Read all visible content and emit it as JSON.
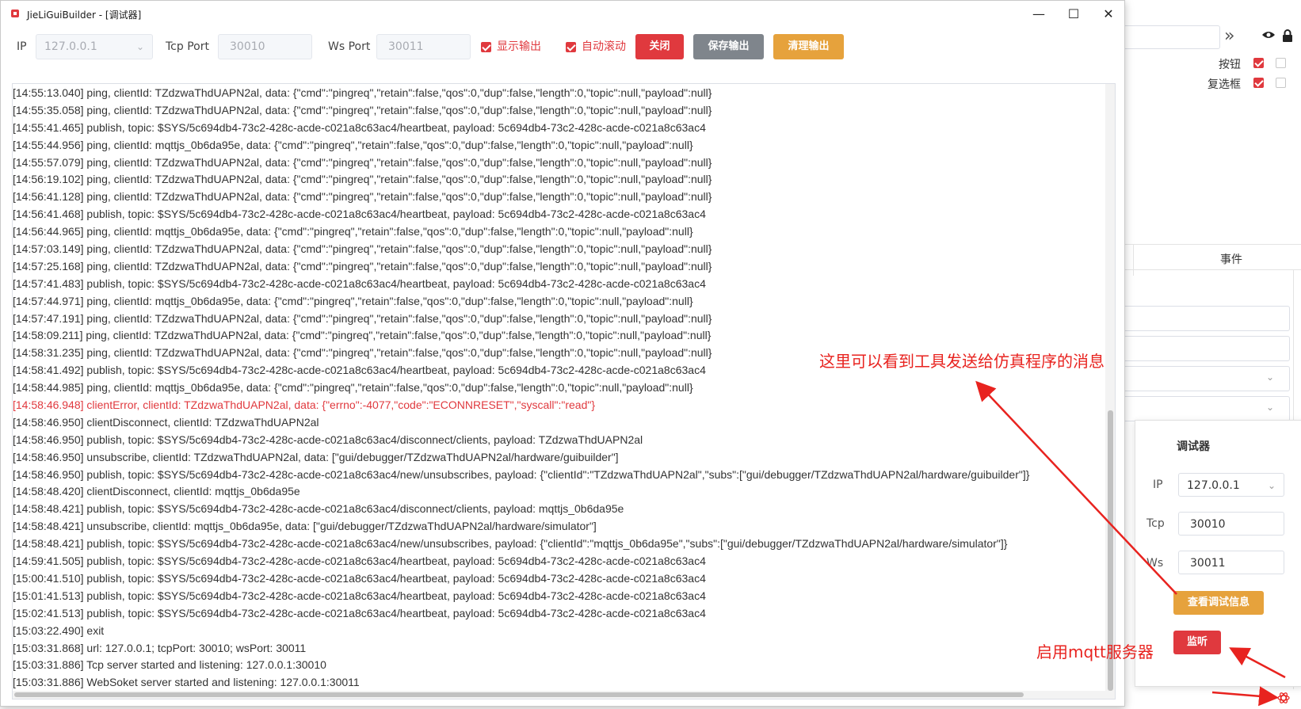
{
  "window": {
    "title": "JieLiGuiBuilder - [调试器]",
    "controls": {
      "minimize": "—",
      "maximize": "☐",
      "close": "✕"
    }
  },
  "toolbar": {
    "ip_label": "IP",
    "ip_value": "127.0.0.1",
    "tcp_label": "Tcp Port",
    "tcp_value": "30010",
    "ws_label": "Ws Port",
    "ws_value": "30011",
    "show_output_label": "显示输出",
    "show_output_checked": true,
    "auto_scroll_label": "自动滚动",
    "auto_scroll_checked": true,
    "close_label": "关闭",
    "save_label": "保存输出",
    "clear_label": "清理输出"
  },
  "log_lines": [
    {
      "text": "[14:55:13.040] ping, clientId: TZdzwaThdUAPN2al, data: {\"cmd\":\"pingreq\",\"retain\":false,\"qos\":0,\"dup\":false,\"length\":0,\"topic\":null,\"payload\":null}",
      "error": false
    },
    {
      "text": "[14:55:35.058] ping, clientId: TZdzwaThdUAPN2al, data: {\"cmd\":\"pingreq\",\"retain\":false,\"qos\":0,\"dup\":false,\"length\":0,\"topic\":null,\"payload\":null}",
      "error": false
    },
    {
      "text": "[14:55:41.465] publish, topic: $SYS/5c694db4-73c2-428c-acde-c021a8c63ac4/heartbeat, payload: 5c694db4-73c2-428c-acde-c021a8c63ac4",
      "error": false
    },
    {
      "text": "[14:55:44.956] ping, clientId: mqttjs_0b6da95e, data: {\"cmd\":\"pingreq\",\"retain\":false,\"qos\":0,\"dup\":false,\"length\":0,\"topic\":null,\"payload\":null}",
      "error": false
    },
    {
      "text": "[14:55:57.079] ping, clientId: TZdzwaThdUAPN2al, data: {\"cmd\":\"pingreq\",\"retain\":false,\"qos\":0,\"dup\":false,\"length\":0,\"topic\":null,\"payload\":null}",
      "error": false
    },
    {
      "text": "[14:56:19.102] ping, clientId: TZdzwaThdUAPN2al, data: {\"cmd\":\"pingreq\",\"retain\":false,\"qos\":0,\"dup\":false,\"length\":0,\"topic\":null,\"payload\":null}",
      "error": false
    },
    {
      "text": "[14:56:41.128] ping, clientId: TZdzwaThdUAPN2al, data: {\"cmd\":\"pingreq\",\"retain\":false,\"qos\":0,\"dup\":false,\"length\":0,\"topic\":null,\"payload\":null}",
      "error": false
    },
    {
      "text": "[14:56:41.468] publish, topic: $SYS/5c694db4-73c2-428c-acde-c021a8c63ac4/heartbeat, payload: 5c694db4-73c2-428c-acde-c021a8c63ac4",
      "error": false
    },
    {
      "text": "[14:56:44.965] ping, clientId: mqttjs_0b6da95e, data: {\"cmd\":\"pingreq\",\"retain\":false,\"qos\":0,\"dup\":false,\"length\":0,\"topic\":null,\"payload\":null}",
      "error": false
    },
    {
      "text": "[14:57:03.149] ping, clientId: TZdzwaThdUAPN2al, data: {\"cmd\":\"pingreq\",\"retain\":false,\"qos\":0,\"dup\":false,\"length\":0,\"topic\":null,\"payload\":null}",
      "error": false
    },
    {
      "text": "[14:57:25.168] ping, clientId: TZdzwaThdUAPN2al, data: {\"cmd\":\"pingreq\",\"retain\":false,\"qos\":0,\"dup\":false,\"length\":0,\"topic\":null,\"payload\":null}",
      "error": false
    },
    {
      "text": "[14:57:41.483] publish, topic: $SYS/5c694db4-73c2-428c-acde-c021a8c63ac4/heartbeat, payload: 5c694db4-73c2-428c-acde-c021a8c63ac4",
      "error": false
    },
    {
      "text": "[14:57:44.971] ping, clientId: mqttjs_0b6da95e, data: {\"cmd\":\"pingreq\",\"retain\":false,\"qos\":0,\"dup\":false,\"length\":0,\"topic\":null,\"payload\":null}",
      "error": false
    },
    {
      "text": "[14:57:47.191] ping, clientId: TZdzwaThdUAPN2al, data: {\"cmd\":\"pingreq\",\"retain\":false,\"qos\":0,\"dup\":false,\"length\":0,\"topic\":null,\"payload\":null}",
      "error": false
    },
    {
      "text": "[14:58:09.211] ping, clientId: TZdzwaThdUAPN2al, data: {\"cmd\":\"pingreq\",\"retain\":false,\"qos\":0,\"dup\":false,\"length\":0,\"topic\":null,\"payload\":null}",
      "error": false
    },
    {
      "text": "[14:58:31.235] ping, clientId: TZdzwaThdUAPN2al, data: {\"cmd\":\"pingreq\",\"retain\":false,\"qos\":0,\"dup\":false,\"length\":0,\"topic\":null,\"payload\":null}",
      "error": false
    },
    {
      "text": "[14:58:41.492] publish, topic: $SYS/5c694db4-73c2-428c-acde-c021a8c63ac4/heartbeat, payload: 5c694db4-73c2-428c-acde-c021a8c63ac4",
      "error": false
    },
    {
      "text": "[14:58:44.985] ping, clientId: mqttjs_0b6da95e, data: {\"cmd\":\"pingreq\",\"retain\":false,\"qos\":0,\"dup\":false,\"length\":0,\"topic\":null,\"payload\":null}",
      "error": false
    },
    {
      "text": "[14:58:46.948] clientError, clientId: TZdzwaThdUAPN2al, data: {\"errno\":-4077,\"code\":\"ECONNRESET\",\"syscall\":\"read\"}",
      "error": true
    },
    {
      "text": "[14:58:46.950] clientDisconnect, clientId: TZdzwaThdUAPN2al",
      "error": false
    },
    {
      "text": "[14:58:46.950] publish, topic: $SYS/5c694db4-73c2-428c-acde-c021a8c63ac4/disconnect/clients, payload: TZdzwaThdUAPN2al",
      "error": false
    },
    {
      "text": "[14:58:46.950] unsubscribe, clientId: TZdzwaThdUAPN2al, data: [\"gui/debugger/TZdzwaThdUAPN2al/hardware/guibuilder\"]",
      "error": false
    },
    {
      "text": "[14:58:46.950] publish, topic: $SYS/5c694db4-73c2-428c-acde-c021a8c63ac4/new/unsubscribes, payload: {\"clientId\":\"TZdzwaThdUAPN2al\",\"subs\":[\"gui/debugger/TZdzwaThdUAPN2al/hardware/guibuilder\"]}",
      "error": false
    },
    {
      "text": "[14:58:48.420] clientDisconnect, clientId: mqttjs_0b6da95e",
      "error": false
    },
    {
      "text": "[14:58:48.421] publish, topic: $SYS/5c694db4-73c2-428c-acde-c021a8c63ac4/disconnect/clients, payload: mqttjs_0b6da95e",
      "error": false
    },
    {
      "text": "[14:58:48.421] unsubscribe, clientId: mqttjs_0b6da95e, data: [\"gui/debugger/TZdzwaThdUAPN2al/hardware/simulator\"]",
      "error": false
    },
    {
      "text": "[14:58:48.421] publish, topic: $SYS/5c694db4-73c2-428c-acde-c021a8c63ac4/new/unsubscribes, payload: {\"clientId\":\"mqttjs_0b6da95e\",\"subs\":[\"gui/debugger/TZdzwaThdUAPN2al/hardware/simulator\"]}",
      "error": false
    },
    {
      "text": "[14:59:41.505] publish, topic: $SYS/5c694db4-73c2-428c-acde-c021a8c63ac4/heartbeat, payload: 5c694db4-73c2-428c-acde-c021a8c63ac4",
      "error": false
    },
    {
      "text": "[15:00:41.510] publish, topic: $SYS/5c694db4-73c2-428c-acde-c021a8c63ac4/heartbeat, payload: 5c694db4-73c2-428c-acde-c021a8c63ac4",
      "error": false
    },
    {
      "text": "[15:01:41.513] publish, topic: $SYS/5c694db4-73c2-428c-acde-c021a8c63ac4/heartbeat, payload: 5c694db4-73c2-428c-acde-c021a8c63ac4",
      "error": false
    },
    {
      "text": "[15:02:41.513] publish, topic: $SYS/5c694db4-73c2-428c-acde-c021a8c63ac4/heartbeat, payload: 5c694db4-73c2-428c-acde-c021a8c63ac4",
      "error": false
    },
    {
      "text": "[15:03:22.490] exit",
      "error": false
    },
    {
      "text": "[15:03:31.868] url: 127.0.0.1; tcpPort: 30010; wsPort: 30011",
      "error": false
    },
    {
      "text": "[15:03:31.886] Tcp server started and listening: 127.0.0.1:30010",
      "error": false
    },
    {
      "text": "[15:03:31.886] WebSoket server started and listening: 127.0.0.1:30011",
      "error": false
    }
  ],
  "background_panel": {
    "row_button_label": "按钮",
    "row_checkbox_label": "复选框",
    "events_tab_label": "事件"
  },
  "debugger_popup": {
    "title": "调试器",
    "ip_label": "IP",
    "ip_value": "127.0.0.1",
    "tcp_label": "Tcp",
    "tcp_value": "30010",
    "ws_label": "Ws",
    "ws_value": "30011",
    "view_info_label": "查看调试信息",
    "listen_label": "监听"
  },
  "annotations": {
    "message_note": "这里可以看到工具发送给仿真程序的消息",
    "mqtt_note": "启用mqtt服务器"
  },
  "colors": {
    "accent_red": "#e0393e",
    "gray_button": "#7f858c",
    "orange_button": "#e6a23c",
    "annotation_red": "#e8231f"
  }
}
